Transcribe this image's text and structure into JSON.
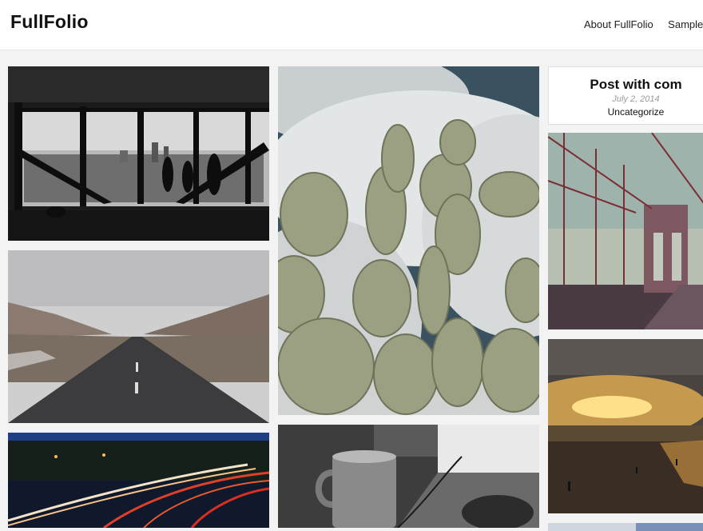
{
  "site": {
    "title": "FullFolio"
  },
  "nav": {
    "items": [
      "About FullFolio",
      "Sample Pa"
    ]
  },
  "post": {
    "title": "Post with com",
    "date": "July 2, 2014",
    "category": "Uncategorize"
  },
  "tiles": [
    {
      "name": "photo-office-skyline"
    },
    {
      "name": "photo-road-valley"
    },
    {
      "name": "photo-light-trails"
    },
    {
      "name": "photo-cactus"
    },
    {
      "name": "photo-coffee-mug"
    },
    {
      "name": "photo-bridge"
    },
    {
      "name": "photo-sunset-beach"
    },
    {
      "name": "photo-partial"
    }
  ]
}
